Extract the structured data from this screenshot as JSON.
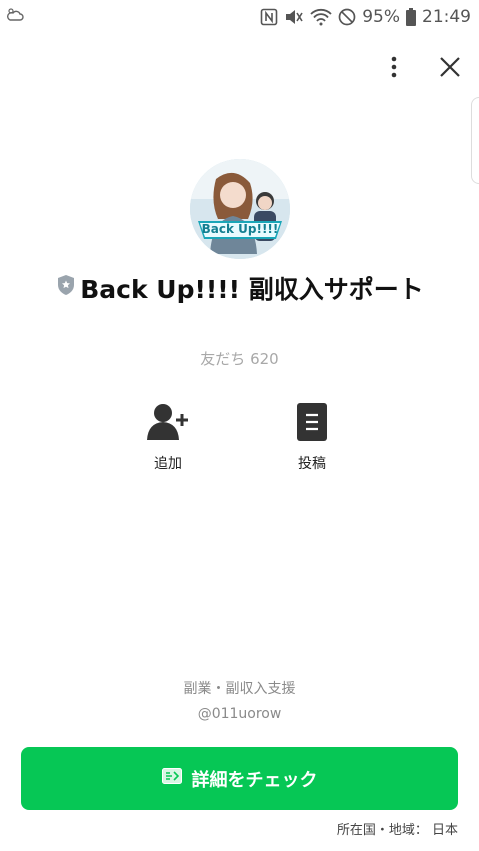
{
  "status_bar": {
    "battery": "95%",
    "time": "21:49"
  },
  "profile": {
    "name": "Back Up!!!! 副収入サポート",
    "friends": "友だち 620",
    "avatar_text": "Back Up!!!!"
  },
  "actions": {
    "add_label": "追加",
    "posts_label": "投稿"
  },
  "info": {
    "category": "副業・副収入支援",
    "line_id": "@011uorow"
  },
  "button": {
    "label": "詳細をチェック"
  },
  "region": "所在国・地域： 日本",
  "colors": {
    "accent": "#06c755",
    "text": "#111111",
    "muted": "#a8a8a8"
  }
}
